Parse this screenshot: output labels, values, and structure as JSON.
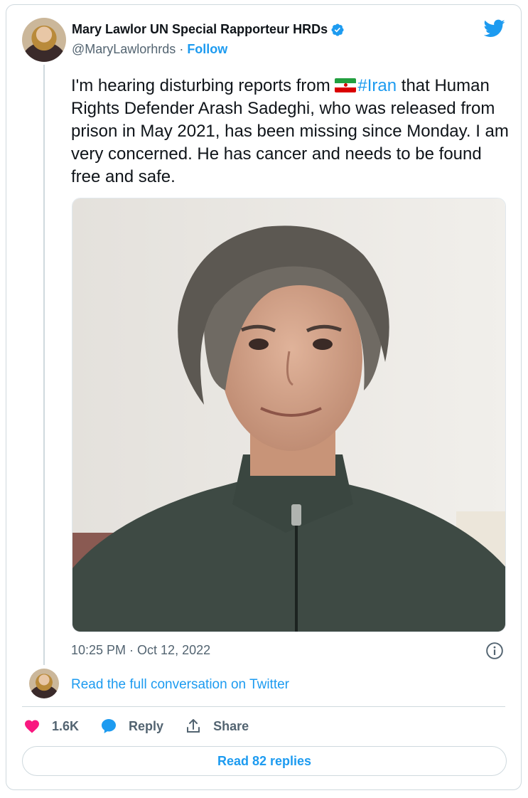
{
  "author": {
    "display_name": "Mary Lawlor UN Special Rapporteur HRDs",
    "handle": "@MaryLawlorhrds",
    "separator": " · ",
    "follow_label": "Follow"
  },
  "tweet": {
    "text_before": "I'm hearing disturbing reports from ",
    "hashtag": "#Iran",
    "text_after": " that Human Rights Defender Arash Sadeghi, who was released from prison in May 2021, has been missing since Monday. I am very concerned. He has cancer and needs to be found free and safe.",
    "timestamp": "10:25 PM · Oct 12, 2022"
  },
  "conversation_link": "Read the full conversation on Twitter",
  "actions": {
    "like_count": "1.6K",
    "reply_label": "Reply",
    "share_label": "Share"
  },
  "read_replies_label": "Read 82 replies",
  "colors": {
    "accent": "#1d9bf0",
    "like": "#f91880",
    "muted": "#536471",
    "border": "#cfd9de"
  },
  "icons": [
    "verified-badge-icon",
    "twitter-bird-icon",
    "info-icon",
    "heart-icon",
    "reply-bubble-icon",
    "share-icon",
    "iran-flag-icon"
  ]
}
